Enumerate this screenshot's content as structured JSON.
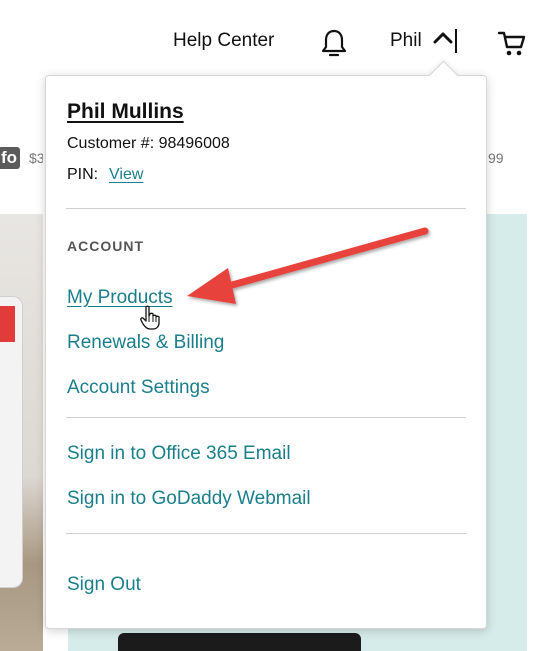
{
  "header": {
    "help_label": "Help Center",
    "user_label": "Phil",
    "icons": [
      "bell-icon",
      "chevron-up-icon",
      "cart-icon"
    ]
  },
  "background": {
    "badge_text": "fo",
    "price_left": "$3",
    "price_right": "99"
  },
  "account_menu": {
    "full_name": "Phil Mullins",
    "customer_number": "Customer #: 98496008",
    "pin_label": "PIN:",
    "pin_link": "View",
    "section_title": "ACCOUNT",
    "items": [
      {
        "label": "My Products"
      },
      {
        "label": "Renewals & Billing"
      },
      {
        "label": "Account Settings"
      },
      {
        "label": "Sign in to Office 365 Email"
      },
      {
        "label": "Sign in to GoDaddy Webmail"
      },
      {
        "label": "Sign Out"
      }
    ]
  },
  "colors": {
    "link": "#1a7f8a",
    "annotation_arrow": "#e8423c",
    "panel_tint": "#d6ecea"
  }
}
